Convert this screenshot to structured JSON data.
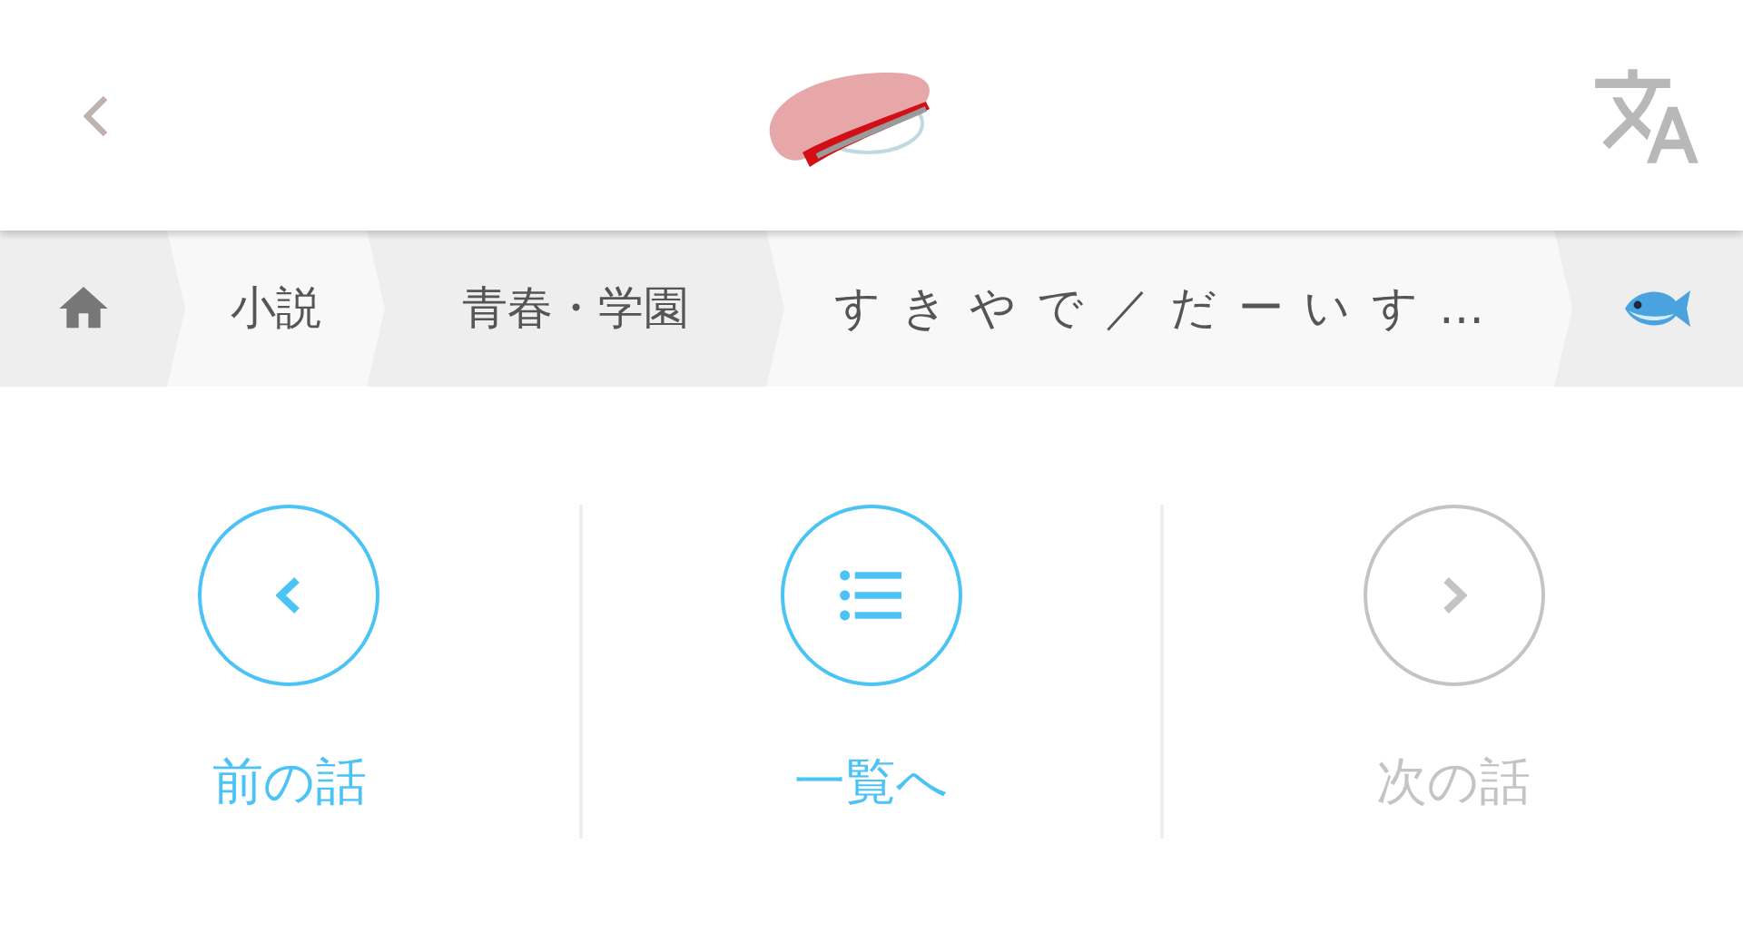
{
  "breadcrumbs": [
    {
      "kind": "home"
    },
    {
      "kind": "text",
      "label": "小説"
    },
    {
      "kind": "text",
      "label": "青春・学園"
    },
    {
      "kind": "title",
      "label": "すきやで／だーいす…"
    },
    {
      "kind": "fish"
    }
  ],
  "nav": [
    {
      "kind": "prev",
      "label": "前の話",
      "disabled": false
    },
    {
      "kind": "list",
      "label": "一覧へ",
      "disabled": false
    },
    {
      "kind": "next",
      "label": "次の話",
      "disabled": true
    }
  ]
}
